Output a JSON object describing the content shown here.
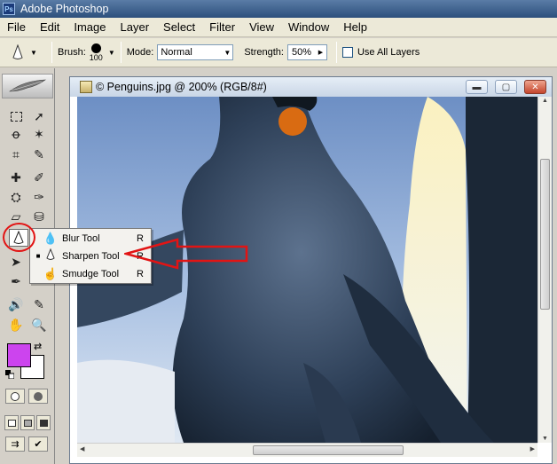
{
  "app": {
    "title": "Adobe Photoshop"
  },
  "menu": {
    "items": [
      "File",
      "Edit",
      "Image",
      "Layer",
      "Select",
      "Filter",
      "View",
      "Window",
      "Help"
    ]
  },
  "options": {
    "brush_label": "Brush:",
    "brush_size": "100",
    "mode_label": "Mode:",
    "mode_value": "Normal",
    "strength_label": "Strength:",
    "strength_value": "50%",
    "use_all_layers_label": "Use All Layers",
    "use_all_layers_checked": false
  },
  "document": {
    "title": "© Penguins.jpg @ 200% (RGB/8#)",
    "buttons": {
      "minimize": "▬",
      "restore": "▢",
      "close": "✕"
    }
  },
  "toolbox": {
    "foreground_color": "#cc44ee",
    "background_color": "#ffffff"
  },
  "flyout": {
    "items": [
      {
        "label": "Blur Tool",
        "shortcut": "R",
        "icon": "blur-drop-icon",
        "selected": false
      },
      {
        "label": "Sharpen Tool",
        "shortcut": "R",
        "icon": "sharpen-cone-icon",
        "selected": true
      },
      {
        "label": "Smudge Tool",
        "shortcut": "R",
        "icon": "smudge-finger-icon",
        "selected": false
      }
    ]
  },
  "annotations": {
    "color": "#e21414"
  }
}
